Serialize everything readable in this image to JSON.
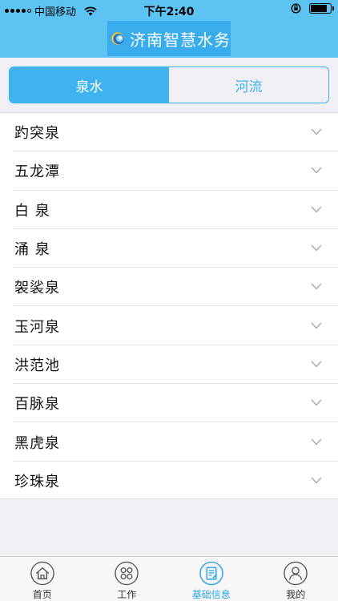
{
  "status_bar": {
    "carrier": "中国移动",
    "time": "下午2:40",
    "battery_level": 0.85
  },
  "header": {
    "title": "济南智慧水务"
  },
  "segmented": {
    "tabs": [
      {
        "label": "泉水",
        "active": true
      },
      {
        "label": "河流",
        "active": false
      }
    ]
  },
  "springs": {
    "items": [
      {
        "label": "趵突泉"
      },
      {
        "label": "五龙潭"
      },
      {
        "label": "白 泉"
      },
      {
        "label": "涌 泉"
      },
      {
        "label": "袈裟泉"
      },
      {
        "label": "玉河泉"
      },
      {
        "label": "洪范池"
      },
      {
        "label": "百脉泉"
      },
      {
        "label": "黑虎泉"
      },
      {
        "label": "珍珠泉"
      }
    ]
  },
  "tabbar": {
    "items": [
      {
        "label": "首页",
        "icon": "home-icon",
        "active": false
      },
      {
        "label": "工作",
        "icon": "grid-icon",
        "active": false
      },
      {
        "label": "基础信息",
        "icon": "document-icon",
        "active": true
      },
      {
        "label": "我的",
        "icon": "user-icon",
        "active": false
      }
    ]
  },
  "colors": {
    "header": "#5cc3f2",
    "accent": "#3fb3ef",
    "active_tab": "#2aa4e8"
  }
}
